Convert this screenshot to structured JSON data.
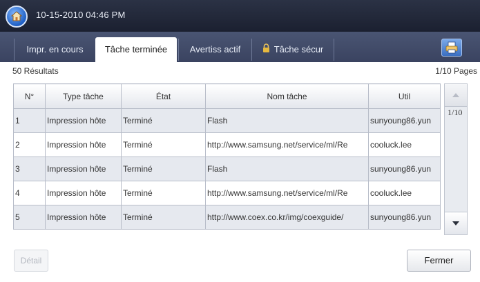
{
  "header": {
    "datetime": "10-15-2010 04:46 PM"
  },
  "tabs": [
    {
      "label": "Impr. en cours",
      "active": false
    },
    {
      "label": "Tâche terminée",
      "active": true
    },
    {
      "label": "Avertiss actif",
      "active": false
    },
    {
      "label": "Tâche sécur",
      "active": false
    }
  ],
  "summary": {
    "results": "50 Résultats",
    "pages": "1/10 Pages"
  },
  "table": {
    "columns": [
      "N°",
      "Type tâche",
      "État",
      "Nom tâche",
      "Util"
    ],
    "rows": [
      [
        "1",
        "Impression hôte",
        "Terminé",
        "Flash",
        "sunyoung86.yun"
      ],
      [
        "2",
        "Impression hôte",
        "Terminé",
        "http://www.samsung.net/service/ml/Re",
        "cooluck.lee"
      ],
      [
        "3",
        "Impression hôte",
        "Terminé",
        "Flash",
        "sunyoung86.yun"
      ],
      [
        "4",
        "Impression hôte",
        "Terminé",
        "http://www.samsung.net/service/ml/Re",
        "cooluck.lee"
      ],
      [
        "5",
        "Impression hôte",
        "Terminé",
        "http://www.coex.co.kr/img/coexguide/",
        "sunyoung86.yun"
      ]
    ]
  },
  "scroll": {
    "page": "1/10"
  },
  "footer": {
    "detail_label": "Détail",
    "close_label": "Fermer"
  },
  "icons": {
    "home": "home-icon",
    "lock": "lock-icon",
    "print": "print-icon",
    "up": "arrow-up-icon",
    "down": "arrow-down-icon"
  },
  "colors": {
    "header": "#1b2030",
    "tabbar": "#3a4360",
    "row_alt": "#e6e9ef"
  }
}
